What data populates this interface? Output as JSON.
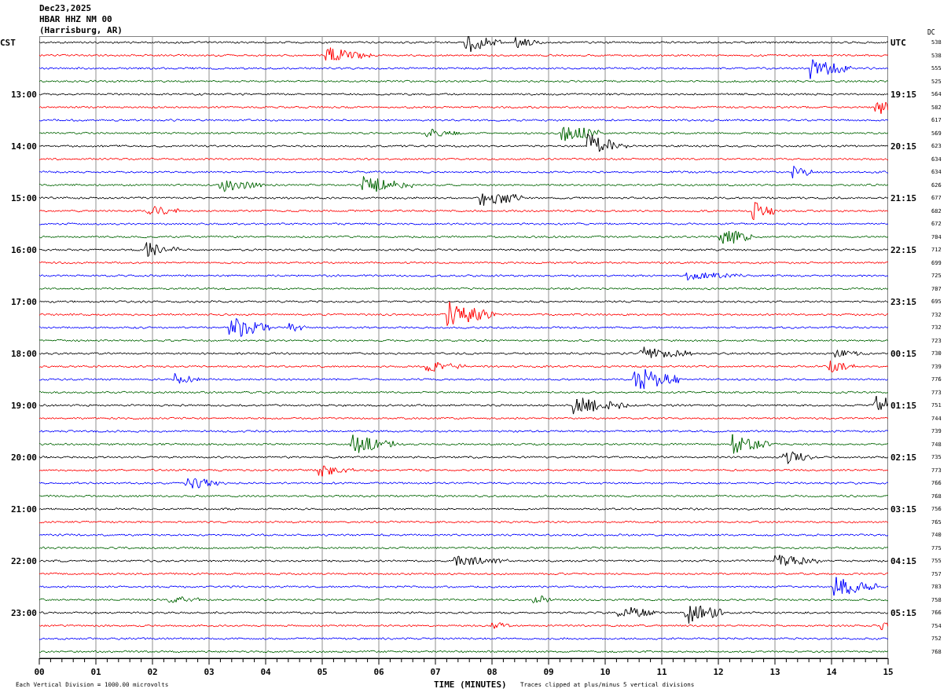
{
  "header": {
    "date": "Dec23,2025",
    "station": "HBAR HHZ NM 00",
    "location": "(Harrisburg, AR)"
  },
  "left_axis_title": "CST",
  "right_axis_title": "UTC",
  "dc_title": "DC",
  "rows": [
    {
      "color": "#000000",
      "dc": "538"
    },
    {
      "color": "#ff0000",
      "dc": "538"
    },
    {
      "color": "#0000ff",
      "dc": "555"
    },
    {
      "color": "#006400",
      "dc": "525"
    },
    {
      "color": "#000000",
      "dc": "564",
      "cst": "13:00",
      "utc": "19:15"
    },
    {
      "color": "#ff0000",
      "dc": "582"
    },
    {
      "color": "#0000ff",
      "dc": "617"
    },
    {
      "color": "#006400",
      "dc": "569"
    },
    {
      "color": "#000000",
      "dc": "623",
      "cst": "14:00",
      "utc": "20:15"
    },
    {
      "color": "#ff0000",
      "dc": "634"
    },
    {
      "color": "#0000ff",
      "dc": "634"
    },
    {
      "color": "#006400",
      "dc": "626"
    },
    {
      "color": "#000000",
      "dc": "677",
      "cst": "15:00",
      "utc": "21:15"
    },
    {
      "color": "#ff0000",
      "dc": "682"
    },
    {
      "color": "#0000ff",
      "dc": "672"
    },
    {
      "color": "#006400",
      "dc": "704"
    },
    {
      "color": "#000000",
      "dc": "712",
      "cst": "16:00",
      "utc": "22:15"
    },
    {
      "color": "#ff0000",
      "dc": "699"
    },
    {
      "color": "#0000ff",
      "dc": "725"
    },
    {
      "color": "#006400",
      "dc": "707"
    },
    {
      "color": "#000000",
      "dc": "695",
      "cst": "17:00",
      "utc": "23:15"
    },
    {
      "color": "#ff0000",
      "dc": "732"
    },
    {
      "color": "#0000ff",
      "dc": "732"
    },
    {
      "color": "#006400",
      "dc": "723"
    },
    {
      "color": "#000000",
      "dc": "730",
      "cst": "18:00",
      "utc": "00:15"
    },
    {
      "color": "#ff0000",
      "dc": "739"
    },
    {
      "color": "#0000ff",
      "dc": "776"
    },
    {
      "color": "#006400",
      "dc": "773"
    },
    {
      "color": "#000000",
      "dc": "751",
      "cst": "19:00",
      "utc": "01:15"
    },
    {
      "color": "#ff0000",
      "dc": "744"
    },
    {
      "color": "#0000ff",
      "dc": "739"
    },
    {
      "color": "#006400",
      "dc": "748"
    },
    {
      "color": "#000000",
      "dc": "735",
      "cst": "20:00",
      "utc": "02:15"
    },
    {
      "color": "#ff0000",
      "dc": "773"
    },
    {
      "color": "#0000ff",
      "dc": "766"
    },
    {
      "color": "#006400",
      "dc": "768"
    },
    {
      "color": "#000000",
      "dc": "756",
      "cst": "21:00",
      "utc": "03:15"
    },
    {
      "color": "#ff0000",
      "dc": "765"
    },
    {
      "color": "#0000ff",
      "dc": "740"
    },
    {
      "color": "#006400",
      "dc": "775"
    },
    {
      "color": "#000000",
      "dc": "755",
      "cst": "22:00",
      "utc": "04:15"
    },
    {
      "color": "#ff0000",
      "dc": "757"
    },
    {
      "color": "#0000ff",
      "dc": "783"
    },
    {
      "color": "#006400",
      "dc": "758"
    },
    {
      "color": "#000000",
      "dc": "766",
      "cst": "23:00",
      "utc": "05:15"
    },
    {
      "color": "#ff0000",
      "dc": "754"
    },
    {
      "color": "#0000ff",
      "dc": "752"
    },
    {
      "color": "#006400",
      "dc": "768"
    }
  ],
  "x_axis": {
    "labels": [
      "00",
      "01",
      "02",
      "03",
      "04",
      "05",
      "06",
      "07",
      "08",
      "09",
      "10",
      "11",
      "12",
      "13",
      "14",
      "15"
    ],
    "title": "TIME (MINUTES)"
  },
  "footer": {
    "scale_note": "Each Vertical Division = 1000.00 microvolts",
    "clip_note": "Traces clipped at plus/minus 5 vertical divisions"
  }
}
